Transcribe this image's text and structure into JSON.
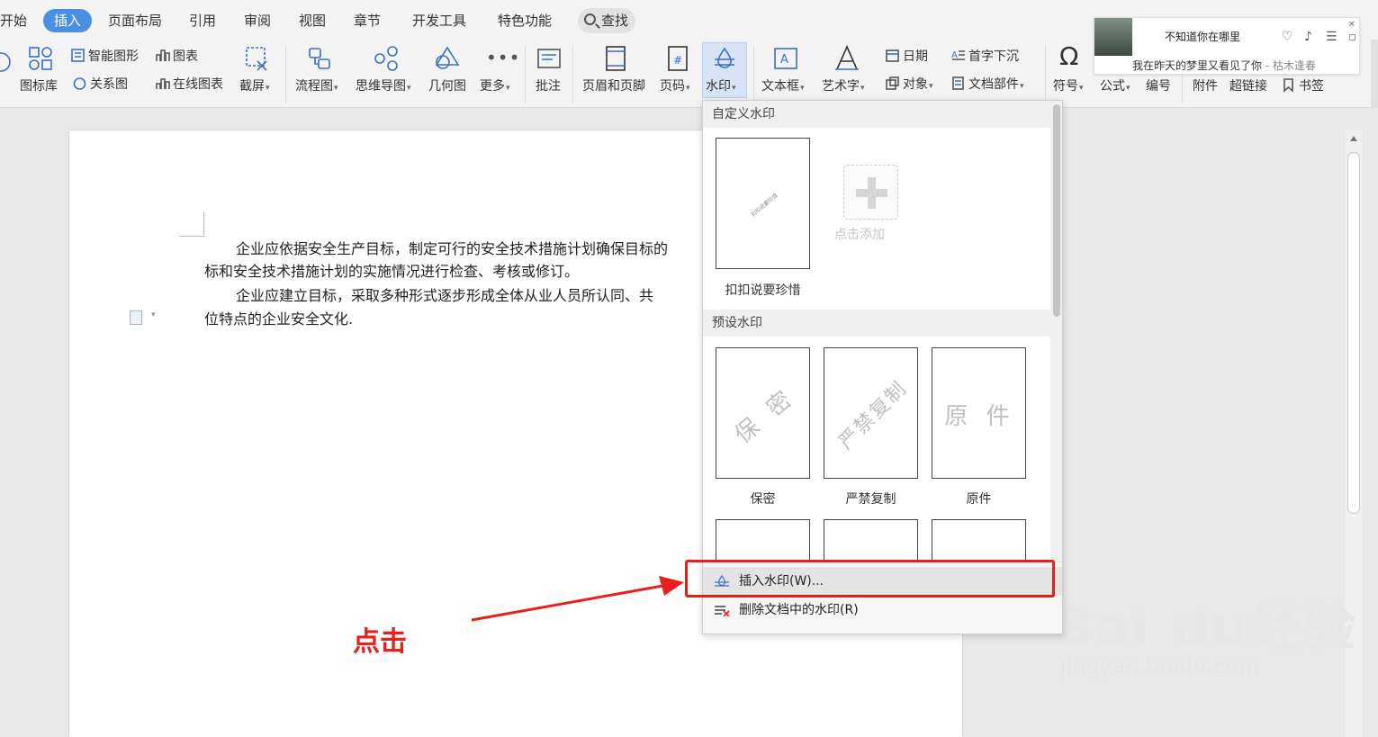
{
  "tabs": [
    {
      "label": "开始"
    },
    {
      "label": "插入"
    },
    {
      "label": "页面布局"
    },
    {
      "label": "引用"
    },
    {
      "label": "审阅"
    },
    {
      "label": "视图"
    },
    {
      "label": "章节"
    },
    {
      "label": "开发工具"
    },
    {
      "label": "特色功能"
    }
  ],
  "search_label": "查找",
  "ribbon": {
    "icon_lib": "图标库",
    "smart_shape": "智能图形",
    "chart": "图表",
    "relation_chart": "关系图",
    "online_chart": "在线图表",
    "screenshot": "截屏",
    "flowchart": "流程图",
    "mindmap": "思维导图",
    "geometry": "几何图",
    "more": "更多",
    "comment": "批注",
    "header_footer": "页眉和页脚",
    "page_number": "页码",
    "watermark": "水印",
    "textbox": "文本框",
    "wordart": "艺术字",
    "date": "日期",
    "object": "对象",
    "drop_cap": "首字下沉",
    "doc_parts": "文档部件",
    "symbol": "符号",
    "formula": "公式",
    "numbering": "编号",
    "attachment": "附件",
    "hyperlink": "超链接",
    "bookmark": "书签"
  },
  "music": {
    "song": "不知道你在哪里",
    "lyric": "我在昨天的梦里又看见了你",
    "artist": "- 枯木逢春"
  },
  "document": {
    "p1_line1": "企业应依据安全生产目标，制定可行的安全技术措施计划确保目标的",
    "p1_line2": "标和安全技术措施计划的实施情况进行检查、考核或修订。",
    "p2_line1": "企业应建立目标，采取多种形式逐步形成全体从业人员所认同、共",
    "p2_line2": "位特点的企业安全文化."
  },
  "watermark_menu": {
    "custom_title": "自定义水印",
    "custom_item_label": "扣扣说要珍惜",
    "custom_item_text": "扣扣说要珍惜",
    "add_label": "点击添加",
    "preset_title": "预设水印",
    "presets": [
      {
        "label": "保密",
        "text": "保 密"
      },
      {
        "label": "严禁复制",
        "text": "严禁复制"
      },
      {
        "label": "原件",
        "text": "原 件"
      }
    ],
    "insert_label": "插入水印(W)...",
    "delete_label": "删除文档中的水印(R)"
  },
  "annotation": {
    "click_label": "点击",
    "color": "#e8201c"
  },
  "baidu_watermark": {
    "brand": "Bai du经验",
    "url": "jingyan.baidu.com"
  },
  "colors": {
    "accent": "#4a90e2",
    "highlight_button": "#d6e4f5"
  }
}
